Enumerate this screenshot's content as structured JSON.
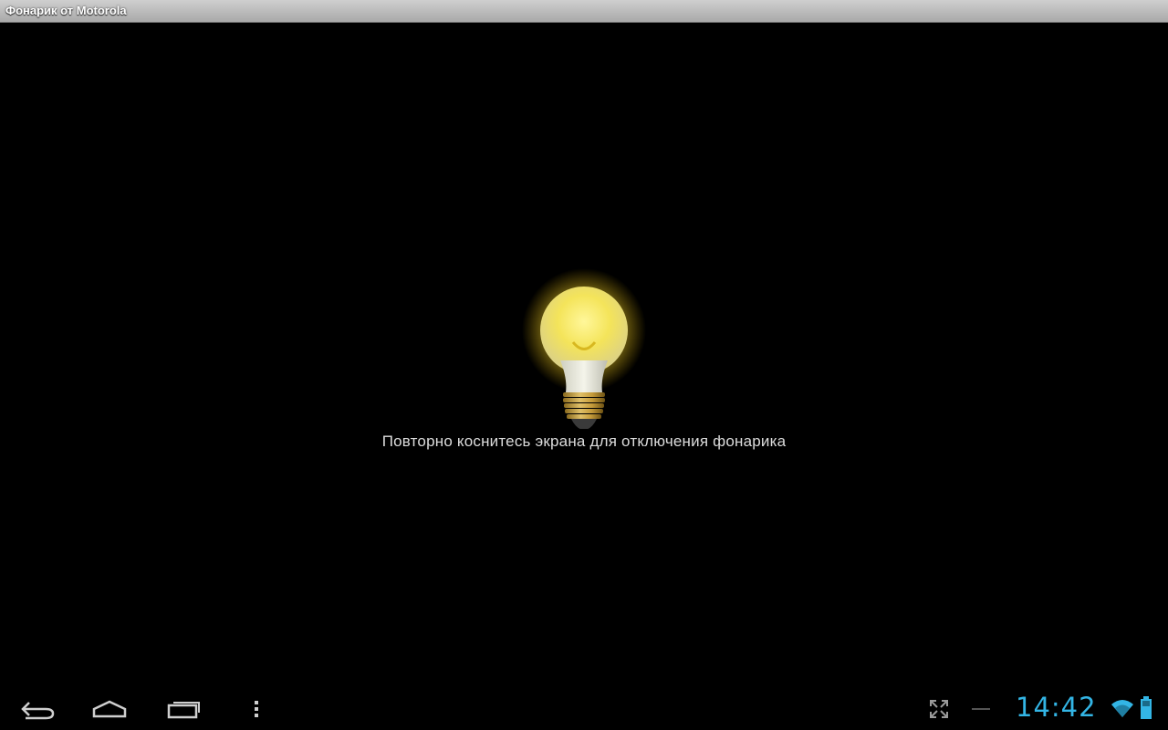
{
  "window": {
    "title": "Фонарик от Motorola"
  },
  "main": {
    "bulb_icon": "lightbulb-on-icon",
    "hint_text": "Повторно коснитесь экрана для отключения фонарика"
  },
  "navbar": {
    "back_icon": "back-icon",
    "home_icon": "home-icon",
    "recents_icon": "recent-apps-icon",
    "menu_icon": "overflow-menu-icon"
  },
  "status": {
    "fullscreen_icon": "expand-icon",
    "notification_icon": "notification-dash-icon",
    "time": "14:42",
    "wifi_icon": "wifi-icon",
    "battery_icon": "battery-icon"
  },
  "colors": {
    "accent": "#33b5e5",
    "background": "#000000",
    "bulb_glow": "#f5e04a"
  }
}
